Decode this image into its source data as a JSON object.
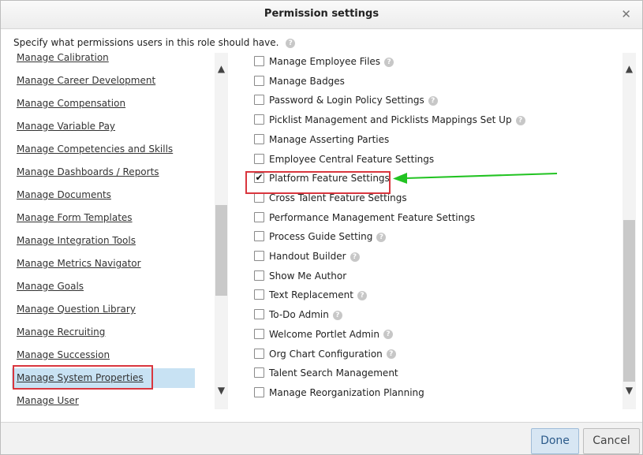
{
  "dialog": {
    "title": "Permission settings",
    "close_glyph": "✕",
    "instruction": "Specify what permissions users in this role should have.",
    "help_glyph": "?"
  },
  "left_items": [
    {
      "label": "Manage Calibration"
    },
    {
      "label": "Manage Career Development"
    },
    {
      "label": "Manage Compensation"
    },
    {
      "label": "Manage Variable Pay"
    },
    {
      "label": "Manage Competencies and Skills"
    },
    {
      "label": "Manage Dashboards / Reports"
    },
    {
      "label": "Manage Documents"
    },
    {
      "label": "Manage Form Templates"
    },
    {
      "label": "Manage Integration Tools"
    },
    {
      "label": "Manage Metrics Navigator"
    },
    {
      "label": "Manage Goals"
    },
    {
      "label": "Manage Question Library"
    },
    {
      "label": "Manage Recruiting"
    },
    {
      "label": "Manage Succession"
    },
    {
      "label": "Manage System Properties",
      "selected": true
    },
    {
      "label": "Manage User"
    }
  ],
  "permissions": [
    {
      "label": "Manage Employee Files",
      "help": true,
      "checked": false
    },
    {
      "label": "Manage Badges",
      "help": false,
      "checked": false
    },
    {
      "label": "Password & Login Policy Settings",
      "help": true,
      "checked": false
    },
    {
      "label": "Picklist Management and Picklists Mappings Set Up",
      "help": true,
      "checked": false
    },
    {
      "label": "Manage Asserting Parties",
      "help": false,
      "checked": false
    },
    {
      "label": "Employee Central Feature Settings",
      "help": false,
      "checked": false
    },
    {
      "label": "Platform Feature Settings",
      "help": false,
      "checked": true
    },
    {
      "label": "Cross Talent Feature Settings",
      "help": false,
      "checked": false
    },
    {
      "label": "Performance Management Feature Settings",
      "help": false,
      "checked": false
    },
    {
      "label": "Process Guide Setting",
      "help": true,
      "checked": false
    },
    {
      "label": "Handout Builder",
      "help": true,
      "checked": false
    },
    {
      "label": "Show Me Author",
      "help": false,
      "checked": false
    },
    {
      "label": "Text Replacement",
      "help": true,
      "checked": false
    },
    {
      "label": "To-Do Admin",
      "help": true,
      "checked": false
    },
    {
      "label": "Welcome Portlet Admin",
      "help": true,
      "checked": false
    },
    {
      "label": "Org Chart Configuration",
      "help": true,
      "checked": false
    },
    {
      "label": "Talent Search Management",
      "help": false,
      "checked": false
    },
    {
      "label": "Manage Reorganization Planning",
      "help": false,
      "checked": false
    }
  ],
  "scroll_arrows": {
    "up": "▲",
    "down": "▼"
  },
  "check_glyph": "✔",
  "annotation": {
    "arrow_color": "#22c322",
    "box_color": "#d9363e"
  },
  "footer": {
    "done_label": "Done",
    "cancel_label": "Cancel"
  }
}
